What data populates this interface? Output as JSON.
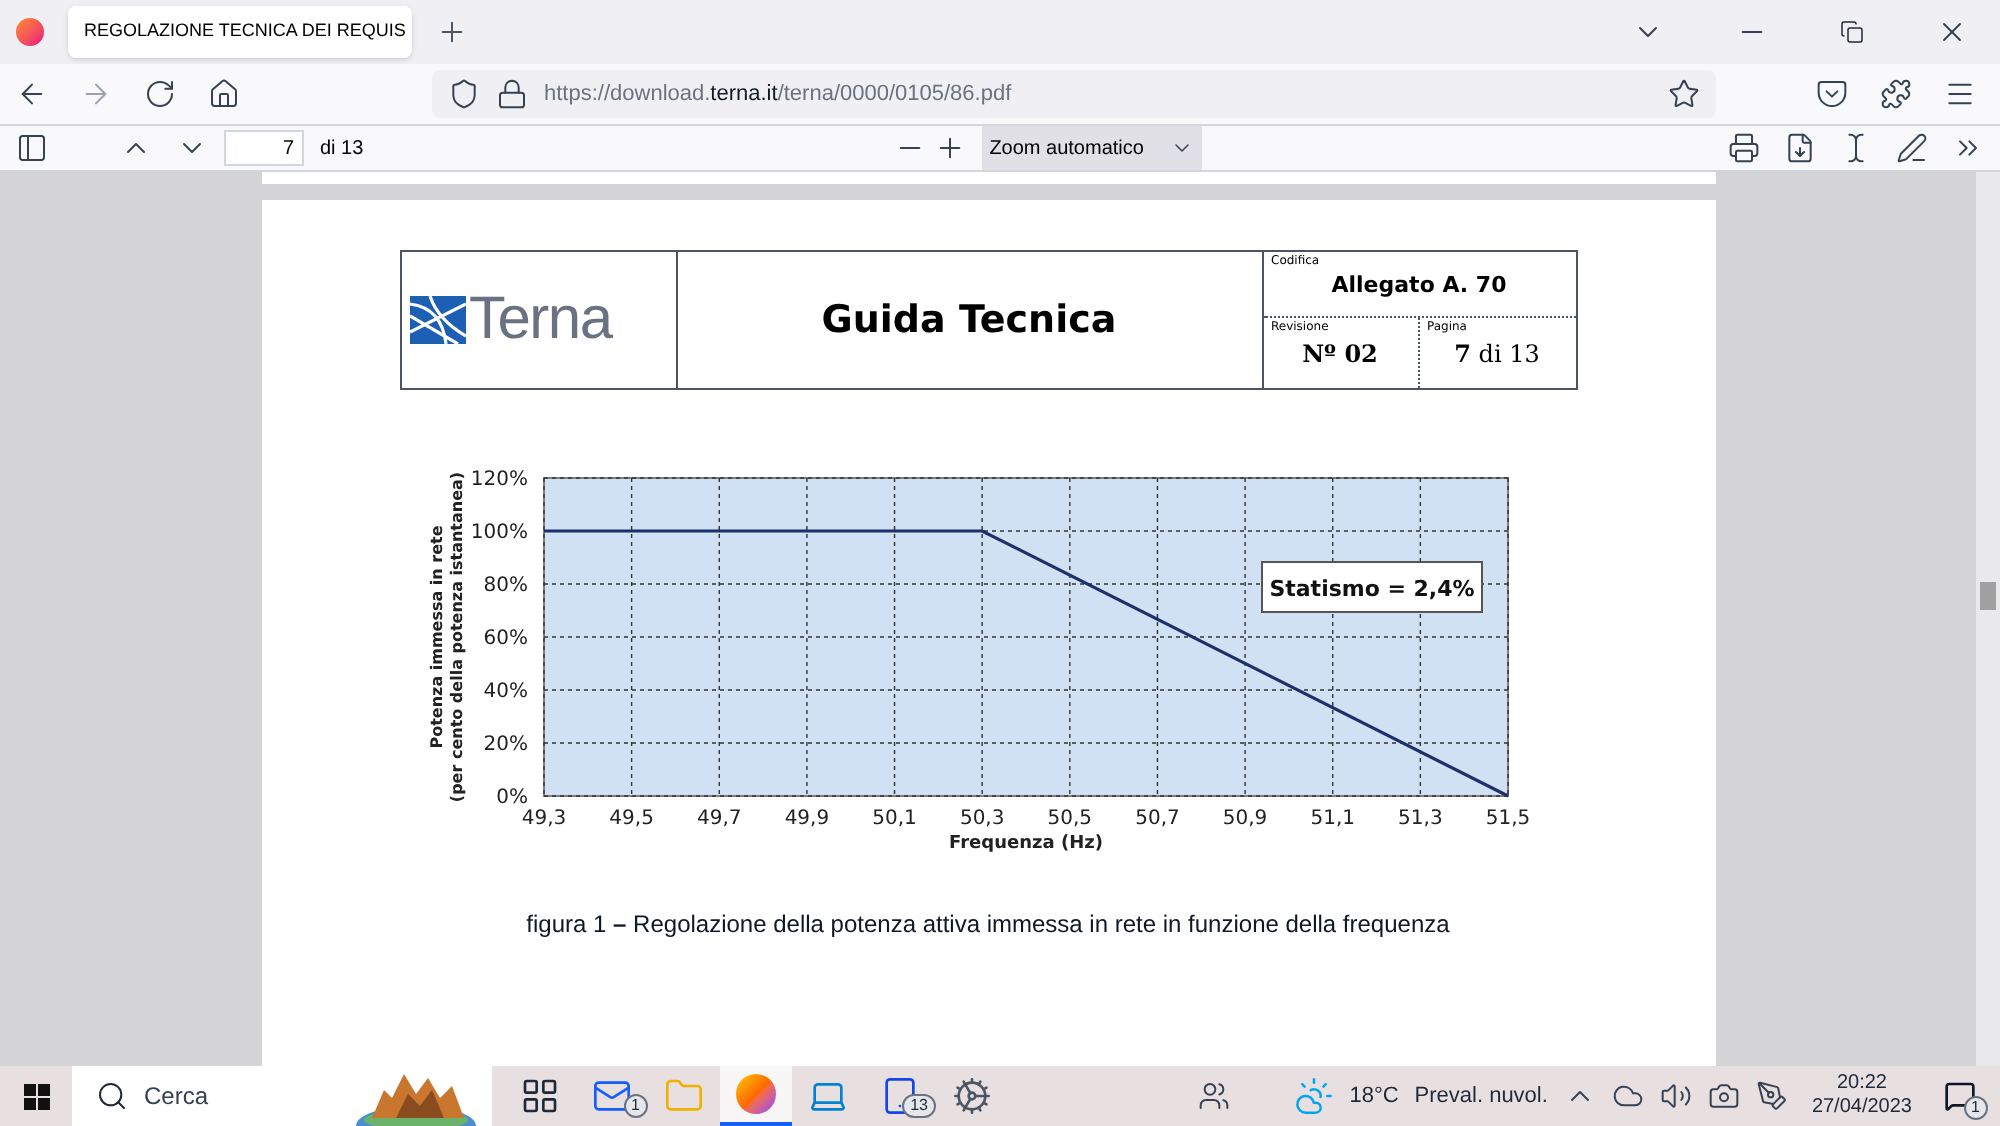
{
  "browser": {
    "tab": {
      "title": "REGOLAZIONE TECNICA DEI REQUIS",
      "selected": true
    },
    "url": {
      "prefix": "https://download.",
      "domain": "terna.it",
      "path": "/terna/0000/0105/86.pdf"
    }
  },
  "pdf_toolbar": {
    "page": "7",
    "page_count": "di 13",
    "zoom": "Zoom automatico"
  },
  "document": {
    "header": {
      "logo": "Terna",
      "title": "Guida Tecnica",
      "code_label": "Codifica",
      "code": "Allegato A. 70",
      "revision_label": "Revisione",
      "revision": "Nº 02",
      "page_label": "Pagina",
      "page": "**7** di 13"
    },
    "chart": {
      "ylabel_lines": [
        "Potenza immessa in rete",
        "(per cento della potenza istantanea)"
      ],
      "chart_data": {
        "type": "line",
        "xlabel": "Frequenza (Hz)",
        "x": [
          49.3,
          50.3,
          51.5
        ],
        "series": [
          {
            "color": "#1f2f6b",
            "values": [
              100,
              100,
              0
            ]
          }
        ],
        "grid": true,
        "xlim": [
          49.3,
          51.5
        ],
        "ylim": [
          0,
          120
        ],
        "xticks": [
          {
            "value": 49.3,
            "label": "49,3"
          },
          {
            "value": 49.5,
            "label": "49,5"
          },
          {
            "value": 49.7,
            "label": "49,7"
          },
          {
            "value": 49.9,
            "label": "49,9"
          },
          {
            "value": 50.1,
            "label": "50,1"
          },
          {
            "value": 50.3,
            "label": "50,3"
          },
          {
            "value": 50.5,
            "label": "50,5"
          },
          {
            "value": 50.7,
            "label": "50,7"
          },
          {
            "value": 50.9,
            "label": "50,9"
          },
          {
            "value": 51.1,
            "label": "51,1"
          },
          {
            "value": 51.3,
            "label": "51,3"
          },
          {
            "value": 51.5,
            "label": "51,5"
          }
        ],
        "yticks": [
          {
            "value": 0,
            "label": "0%"
          },
          {
            "value": 20,
            "label": "20%"
          },
          {
            "value": 40,
            "label": "40%"
          },
          {
            "value": 60,
            "label": "60%"
          },
          {
            "value": 80,
            "label": "80%"
          },
          {
            "value": 100,
            "label": "100%"
          },
          {
            "value": 120,
            "label": "120%"
          }
        ],
        "annotations": [
          "Statismo = 2,4%"
        ]
      }
    },
    "caption": "figura 1 **–** Regolazione della potenza attiva immessa in rete in funzione della frequenza"
  },
  "taskbar": {
    "search": {
      "placeholder": "Cerca"
    },
    "apps": [
      {
        "kind": "taskview",
        "selected": false
      },
      {
        "kind": "mail",
        "badge": "1",
        "selected": false
      },
      {
        "kind": "folder",
        "selected": false
      },
      {
        "kind": "firefox",
        "selected": true
      },
      {
        "kind": "laptop",
        "selected": false
      },
      {
        "kind": "tablet",
        "badge": "13",
        "selected": false
      },
      {
        "kind": "gear",
        "selected": false
      }
    ],
    "weather": {
      "temperature": "18°C",
      "condition": "Preval. nuvol."
    },
    "time": "20:22",
    "date": "27/04/2023",
    "notifications": "1"
  }
}
